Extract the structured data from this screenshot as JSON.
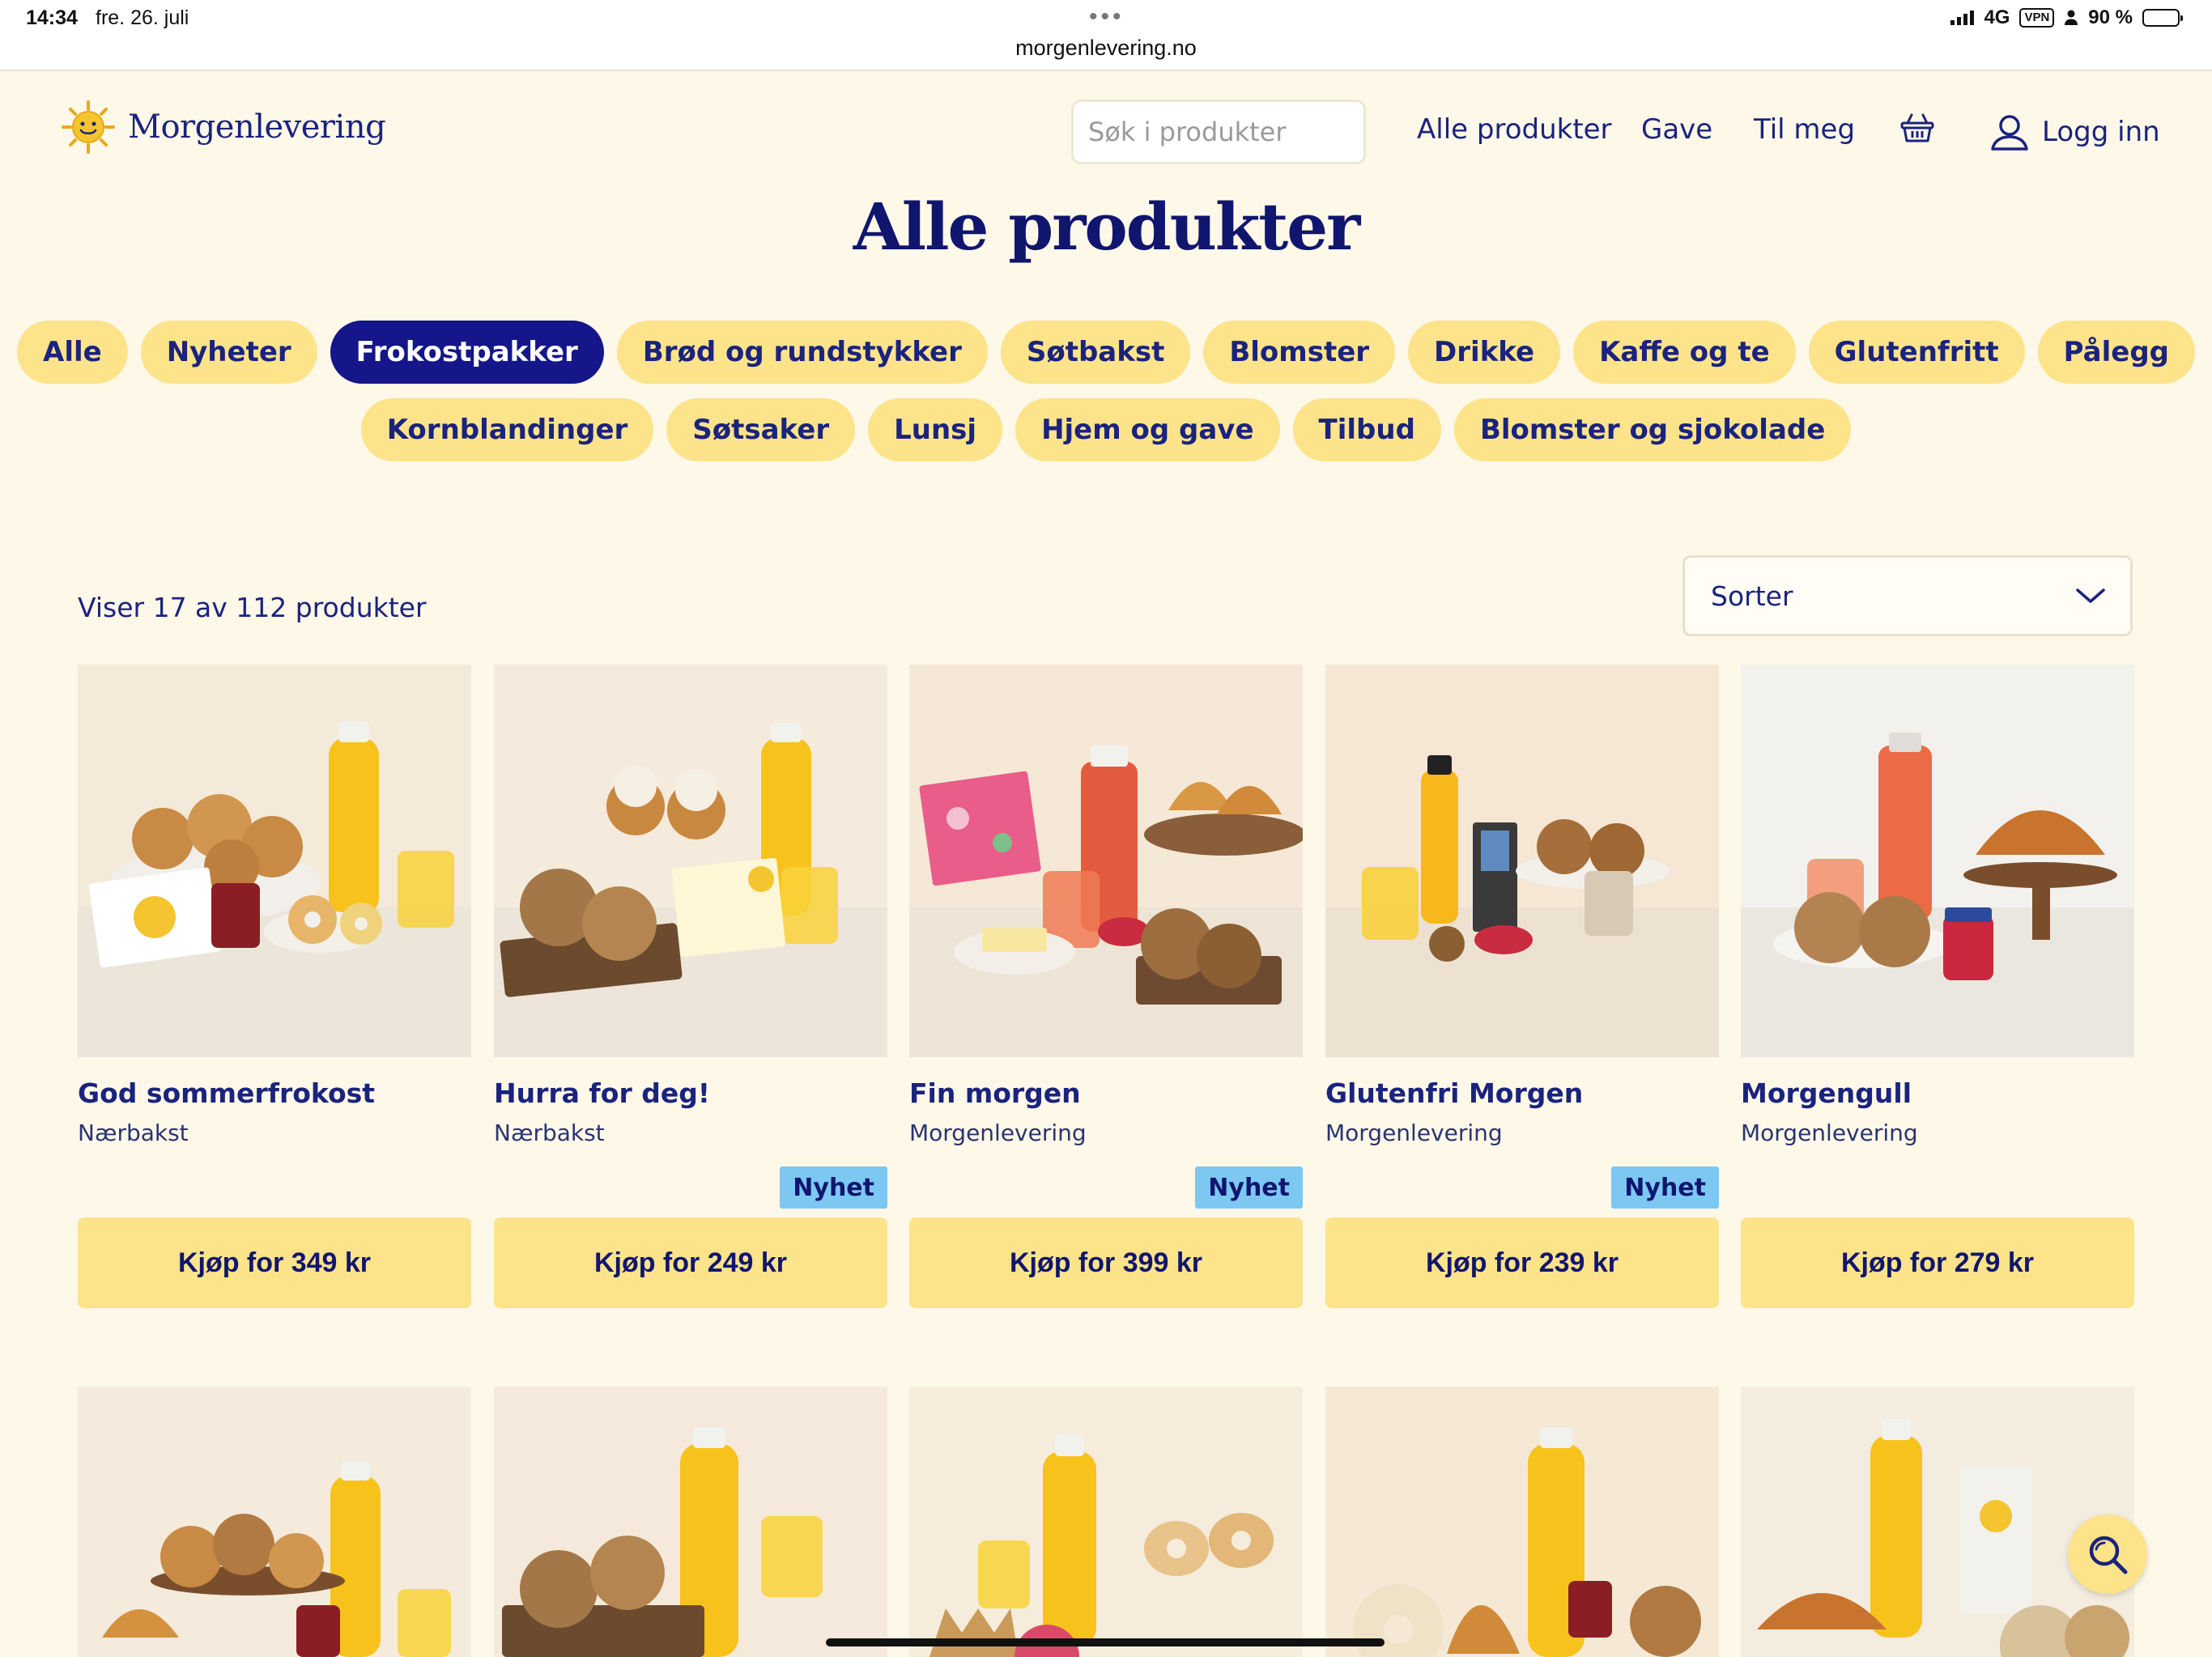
{
  "status_bar": {
    "time": "14:34",
    "date": "fre. 26. juli",
    "url": "morgenlevering.no",
    "network": "4G",
    "vpn": "VPN",
    "battery": "90 %",
    "battery_level": 0.9
  },
  "header": {
    "logo_text": "Morgenlevering",
    "search_placeholder": "Søk i produkter",
    "nav": {
      "all_products": "Alle produkter",
      "gift": "Gave",
      "for_me": "Til meg",
      "login": "Logg inn"
    },
    "icons": [
      "sun-logo-icon",
      "basket-icon",
      "user-icon",
      "search-icon"
    ]
  },
  "page_title": "Alle produkter",
  "categories_row1": [
    {
      "label": "Alle",
      "active": false
    },
    {
      "label": "Nyheter",
      "active": false
    },
    {
      "label": "Frokostpakker",
      "active": true
    },
    {
      "label": "Brød og rundstykker",
      "active": false
    },
    {
      "label": "Søtbakst",
      "active": false
    },
    {
      "label": "Blomster",
      "active": false
    },
    {
      "label": "Drikke",
      "active": false
    },
    {
      "label": "Kaffe og te",
      "active": false
    },
    {
      "label": "Glutenfritt",
      "active": false
    },
    {
      "label": "Pålegg",
      "active": false
    }
  ],
  "categories_row2": [
    {
      "label": "Kornblandinger",
      "active": false
    },
    {
      "label": "Søtsaker",
      "active": false
    },
    {
      "label": "Lunsj",
      "active": false
    },
    {
      "label": "Hjem og gave",
      "active": false
    },
    {
      "label": "Tilbud",
      "active": false
    },
    {
      "label": "Blomster og sjokolade",
      "active": false
    }
  ],
  "results": {
    "count_text": "Viser 17 av 112 produkter",
    "sort_label": "Sorter"
  },
  "products": [
    {
      "name": "God sommerfrokost",
      "brand": "Nærbakst",
      "badge": "",
      "buy": "Kjøp for 349 kr"
    },
    {
      "name": "Hurra for deg!",
      "brand": "Nærbakst",
      "badge": "Nyhet",
      "buy": "Kjøp for 249 kr"
    },
    {
      "name": "Fin morgen",
      "brand": "Morgenlevering",
      "badge": "Nyhet",
      "buy": "Kjøp for 399 kr"
    },
    {
      "name": "Glutenfri Morgen",
      "brand": "Morgenlevering",
      "badge": "Nyhet",
      "buy": "Kjøp for 239 kr"
    },
    {
      "name": "Morgengull",
      "brand": "Morgenlevering",
      "badge": "",
      "buy": "Kjøp for 279 kr"
    }
  ],
  "colors": {
    "background": "#fdf8e8",
    "brand_navy": "#1a237e",
    "chip_yellow": "#fde38a",
    "chip_active": "#14168a",
    "badge_blue": "#7cc8f3"
  }
}
